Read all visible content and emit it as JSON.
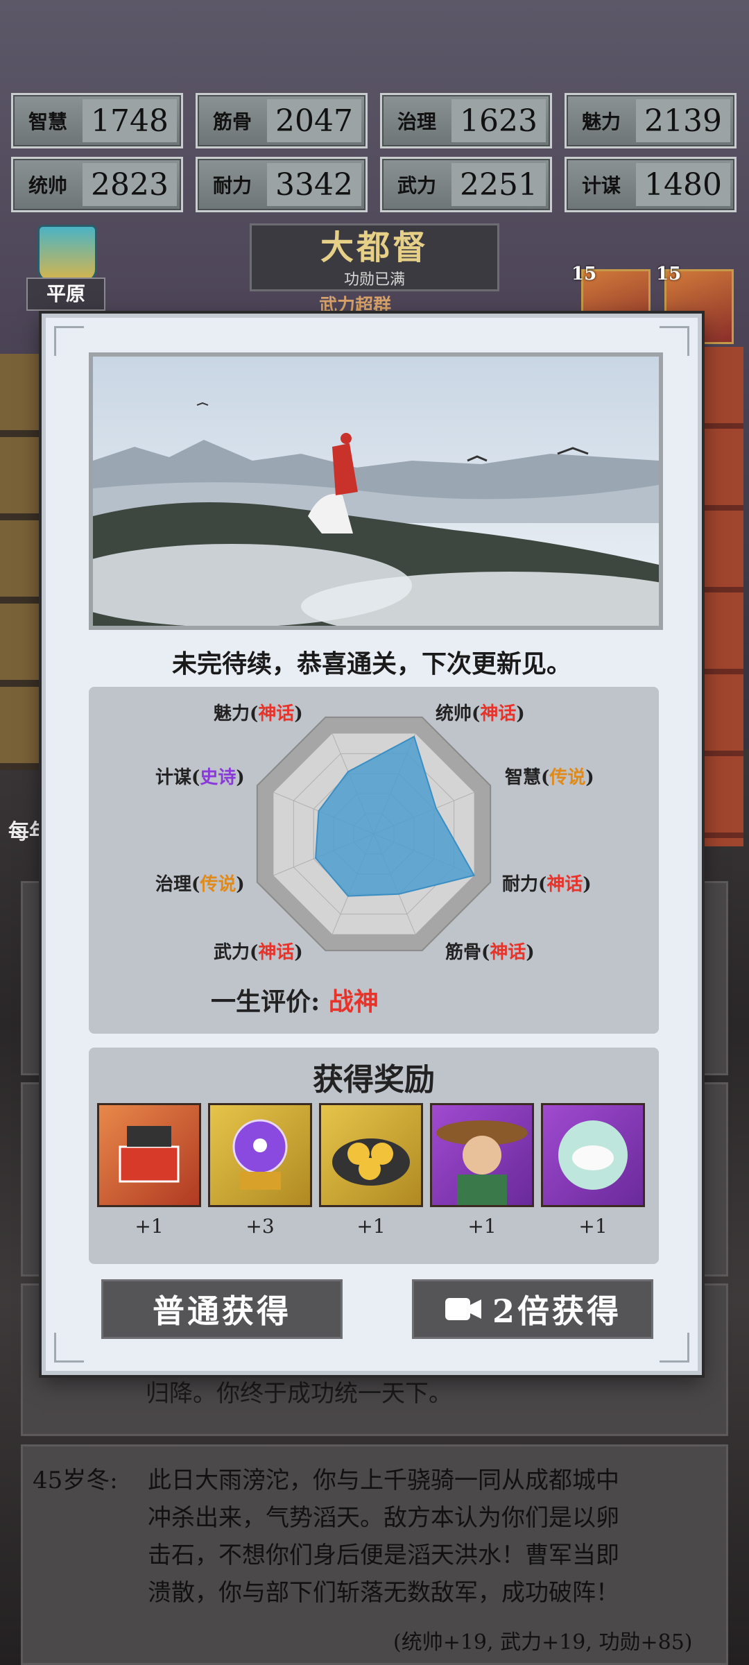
{
  "stats": [
    {
      "label": "智慧",
      "value": "1748"
    },
    {
      "label": "筋骨",
      "value": "2047"
    },
    {
      "label": "治理",
      "value": "1623"
    },
    {
      "label": "魅力",
      "value": "2139"
    },
    {
      "label": "统帅",
      "value": "2823"
    },
    {
      "label": "耐力",
      "value": "3342"
    },
    {
      "label": "武力",
      "value": "2251"
    },
    {
      "label": "计谋",
      "value": "1480"
    }
  ],
  "rank": {
    "title": "大都督",
    "subtitle": "功勋已满",
    "peek": "武力超群"
  },
  "badge": {
    "label": "平原"
  },
  "heroes": [
    {
      "level": "15"
    },
    {
      "level": "15"
    }
  ],
  "log": {
    "peek_text": "归降。你终于成功统一天下。",
    "entry_time": "45岁冬:",
    "entry_text_lines": [
      "此日大雨滂沱，你与上千骁骑一同从成都城中",
      "冲杀出来，气势滔天。敌方本认为你们是以卵",
      "击石，不想你们身后便是滔天洪水！曹军当即",
      "溃散，你与部下们斩落无数敌军，成功破阵！"
    ],
    "entry_result": "(统帅+19, 武力+19, 功勋+85)",
    "side_label": "每年"
  },
  "modal": {
    "caption": "未完待续，恭喜通关，下次更新见。",
    "radar": {
      "axes": [
        {
          "name": "统帅",
          "grade": "神话",
          "color": "#e8332a",
          "level": 0.97
        },
        {
          "name": "智慧",
          "grade": "传说",
          "color": "#e08a1a",
          "level": 0.62
        },
        {
          "name": "耐力",
          "grade": "神话",
          "color": "#e8332a",
          "level": 1.0
        },
        {
          "name": "筋骨",
          "grade": "神话",
          "color": "#e8332a",
          "level": 0.6
        },
        {
          "name": "武力",
          "grade": "神话",
          "color": "#e8332a",
          "level": 0.62
        },
        {
          "name": "治理",
          "grade": "传说",
          "color": "#e08a1a",
          "level": 0.58
        },
        {
          "name": "计谋",
          "grade": "史诗",
          "color": "#8a3ad8",
          "level": 0.55
        },
        {
          "name": "魅力",
          "grade": "神话",
          "color": "#e8332a",
          "level": 0.62
        }
      ],
      "life_label": "一生评价:",
      "life_value": "战神"
    },
    "reward_title": "获得奖励",
    "rewards": [
      {
        "name": "gift-box",
        "count": "+1"
      },
      {
        "name": "crystal-orb",
        "count": "+3"
      },
      {
        "name": "buns-plate",
        "count": "+1"
      },
      {
        "name": "hero-portrait",
        "count": "+1"
      },
      {
        "name": "rice-bowl",
        "count": "+1"
      }
    ],
    "btn_normal": "普通获得",
    "btn_double": "2倍获得"
  }
}
